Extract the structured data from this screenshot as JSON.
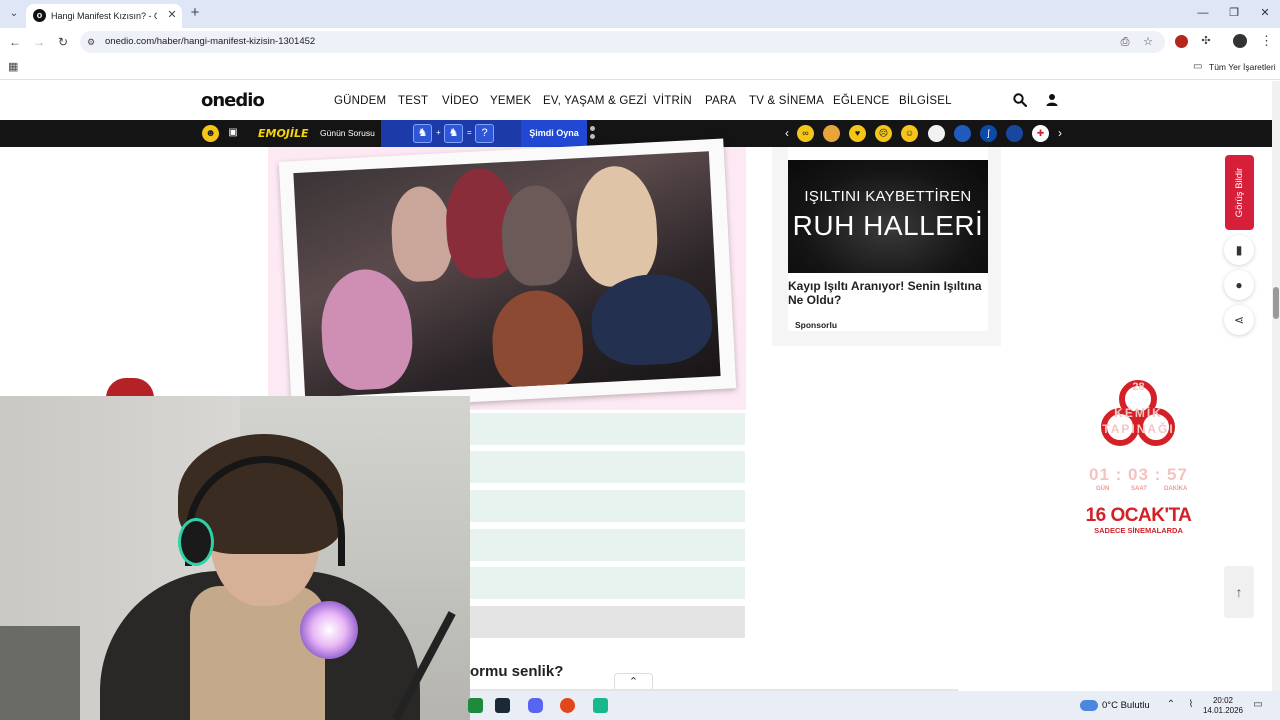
{
  "browser": {
    "tab_title": "Hangi Manifest Kızısın? - Onedio",
    "url": "onedio.com/haber/hangi-manifest-kizisin-1301452",
    "bookmarks_all": "Tüm Yer İşaretleri"
  },
  "site": {
    "logo": "onedio",
    "nav": [
      "GÜNDEM",
      "TEST",
      "VİDEO",
      "YEMEK",
      "EV, YAŞAM & GEZİ",
      "VİTRİN",
      "PARA",
      "TV & SİNEMA",
      "EĞLENCE",
      "BİLGİSEL"
    ]
  },
  "adbar": {
    "brand": "EMOJİLE",
    "question_label": "Günün Sorusu",
    "puzzle_ops": [
      "+",
      "=",
      "?"
    ],
    "play_label": "Şimdi Oyna"
  },
  "article": {
    "question": "ormu senlik?",
    "option_count": 6
  },
  "sidebar_ad": {
    "image_line1": "IŞILTINI KAYBETTİREN",
    "image_line2": "RUH HALLERİ",
    "headline": "Kayıp Işıltı Aranıyor! Senin Işıltına Ne Oldu?",
    "sponsor": "Sponsorlu"
  },
  "floating": {
    "feedback": "Görüş Bildir"
  },
  "movie_ad": {
    "number": "28",
    "title": "KEMİK TAPINAĞI",
    "countdown": "01 : 03 : 57",
    "labels": [
      "GÜN",
      "SAAT",
      "DAKİKA"
    ],
    "date": "16 OCAK'TA",
    "subtitle": "SADECE SİNEMALARDA"
  },
  "taskbar": {
    "weather": "0°C  Bulutlu",
    "time": "20:02",
    "date": "14.01.2026"
  },
  "colors": {
    "accent_red": "#d6203a",
    "ad_blue": "#2148d2",
    "ad_yellow": "#f5d50a",
    "option_bg": "#e8f2ee"
  }
}
